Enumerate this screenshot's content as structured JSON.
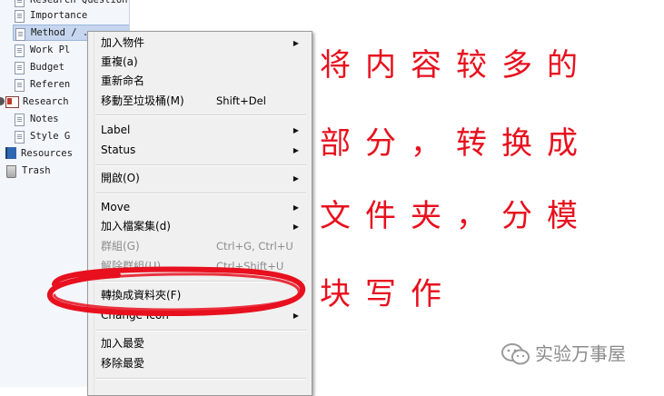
{
  "sidebar": {
    "items": [
      {
        "label": "Research Question",
        "icon": "document-icon"
      },
      {
        "label": "Importance",
        "icon": "document-icon"
      },
      {
        "label": "Method  / ...",
        "icon": "document-icon"
      },
      {
        "label": "Work Pl",
        "icon": "document-icon"
      },
      {
        "label": "Budget",
        "icon": "document-icon"
      },
      {
        "label": "Referen",
        "icon": "document-icon"
      },
      {
        "label": "Research",
        "icon": "folder-icon"
      },
      {
        "label": "Notes",
        "icon": "document-icon"
      },
      {
        "label": "Style G",
        "icon": "document-icon"
      },
      {
        "label": "Resources",
        "icon": "book-icon"
      },
      {
        "label": "Trash",
        "icon": "trash-icon"
      }
    ]
  },
  "context_menu": {
    "items": [
      {
        "label": "加入物件",
        "shortcut": "",
        "submenu": true,
        "disabled": false
      },
      {
        "label": "重複(a)",
        "shortcut": "",
        "submenu": false,
        "disabled": false
      },
      {
        "label": "重新命名",
        "shortcut": "",
        "submenu": false,
        "disabled": false
      },
      {
        "label": "移動至垃圾桶(M)",
        "shortcut": "Shift+Del",
        "submenu": false,
        "disabled": false
      },
      {
        "label": "Label",
        "shortcut": "",
        "submenu": true,
        "disabled": false
      },
      {
        "label": "Status",
        "shortcut": "",
        "submenu": true,
        "disabled": false
      },
      {
        "label": "開啟(O)",
        "shortcut": "",
        "submenu": true,
        "disabled": false
      },
      {
        "label": "Move",
        "shortcut": "",
        "submenu": true,
        "disabled": false
      },
      {
        "label": "加入檔案集(d)",
        "shortcut": "",
        "submenu": true,
        "disabled": false
      },
      {
        "label": "群組(G)",
        "shortcut": "Ctrl+G, Ctrl+U",
        "submenu": false,
        "disabled": true
      },
      {
        "label": "解除群組(U)",
        "shortcut": "Ctrl+Shift+U",
        "submenu": false,
        "disabled": true
      },
      {
        "label": "轉換成資料夾(F)",
        "shortcut": "",
        "submenu": false,
        "disabled": false
      },
      {
        "label": "Change Icon",
        "shortcut": "",
        "submenu": true,
        "disabled": false
      },
      {
        "label": "加入最愛",
        "shortcut": "",
        "submenu": false,
        "disabled": false
      },
      {
        "label": "移除最愛",
        "shortcut": "",
        "submenu": false,
        "disabled": false
      }
    ]
  },
  "annotation": {
    "lines": [
      "将内容较多的",
      "部分，转换成",
      "文件夹，分模",
      "块写作"
    ],
    "color": "#e8101e"
  },
  "watermark": {
    "text": "实验万事屋"
  }
}
